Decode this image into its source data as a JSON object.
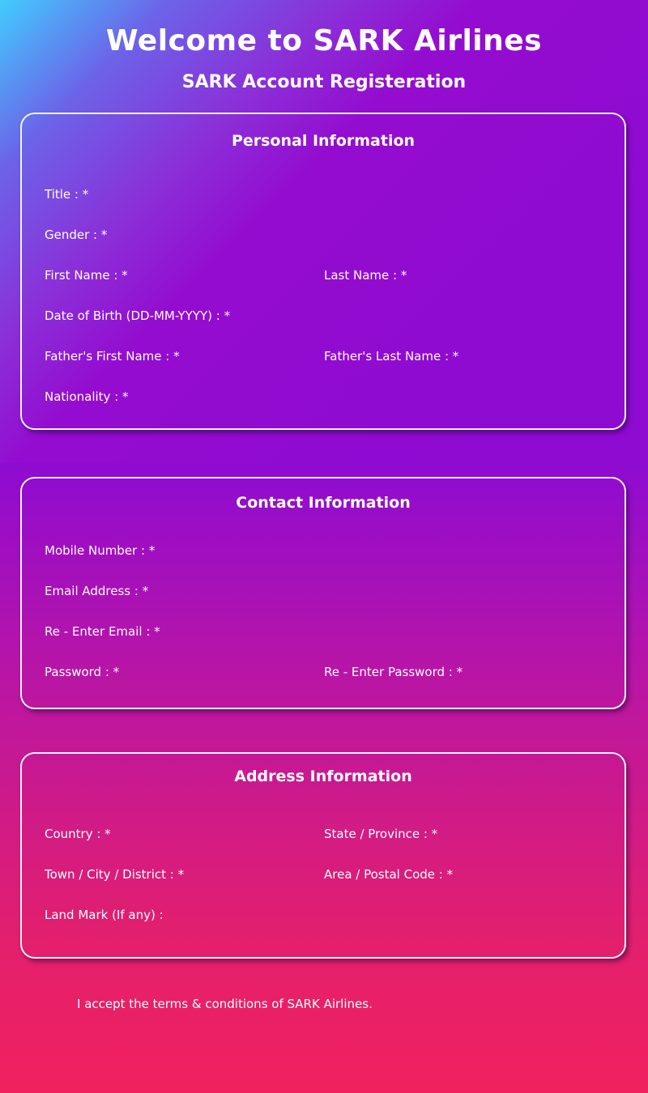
{
  "header": {
    "title": "Welcome to SARK Airlines",
    "subtitle": "SARK Account Registeration"
  },
  "personal": {
    "heading": "Personal Information",
    "title_label": "Title : *",
    "gender_label": "Gender : *",
    "first_name_label": "First Name : *",
    "last_name_label": "Last Name : *",
    "dob_label": "Date of Birth (DD-MM-YYYY) : *",
    "father_first_name_label": "Father's First Name : *",
    "father_last_name_label": "Father's Last Name : *",
    "nationality_label": "Nationality : *"
  },
  "contact": {
    "heading": "Contact Information",
    "mobile_label": "Mobile Number : *",
    "email_label": "Email Address : *",
    "reenter_email_label": "Re - Enter Email : *",
    "password_label": "Password : *",
    "reenter_password_label": "Re - Enter Password : *"
  },
  "address": {
    "heading": "Address Information",
    "country_label": "Country : *",
    "state_label": "State / Province : *",
    "town_label": "Town / City / District : *",
    "postal_label": "Area / Postal Code : *",
    "landmark_label": "Land Mark (If any) :"
  },
  "terms": {
    "text": "I accept the terms & conditions of SARK Airlines."
  },
  "colors": {
    "border": "#f2f2f7",
    "gradient_top_left": "#41ccff",
    "gradient_purple": "#8e0bd2",
    "gradient_bottom": "#f1215e"
  }
}
